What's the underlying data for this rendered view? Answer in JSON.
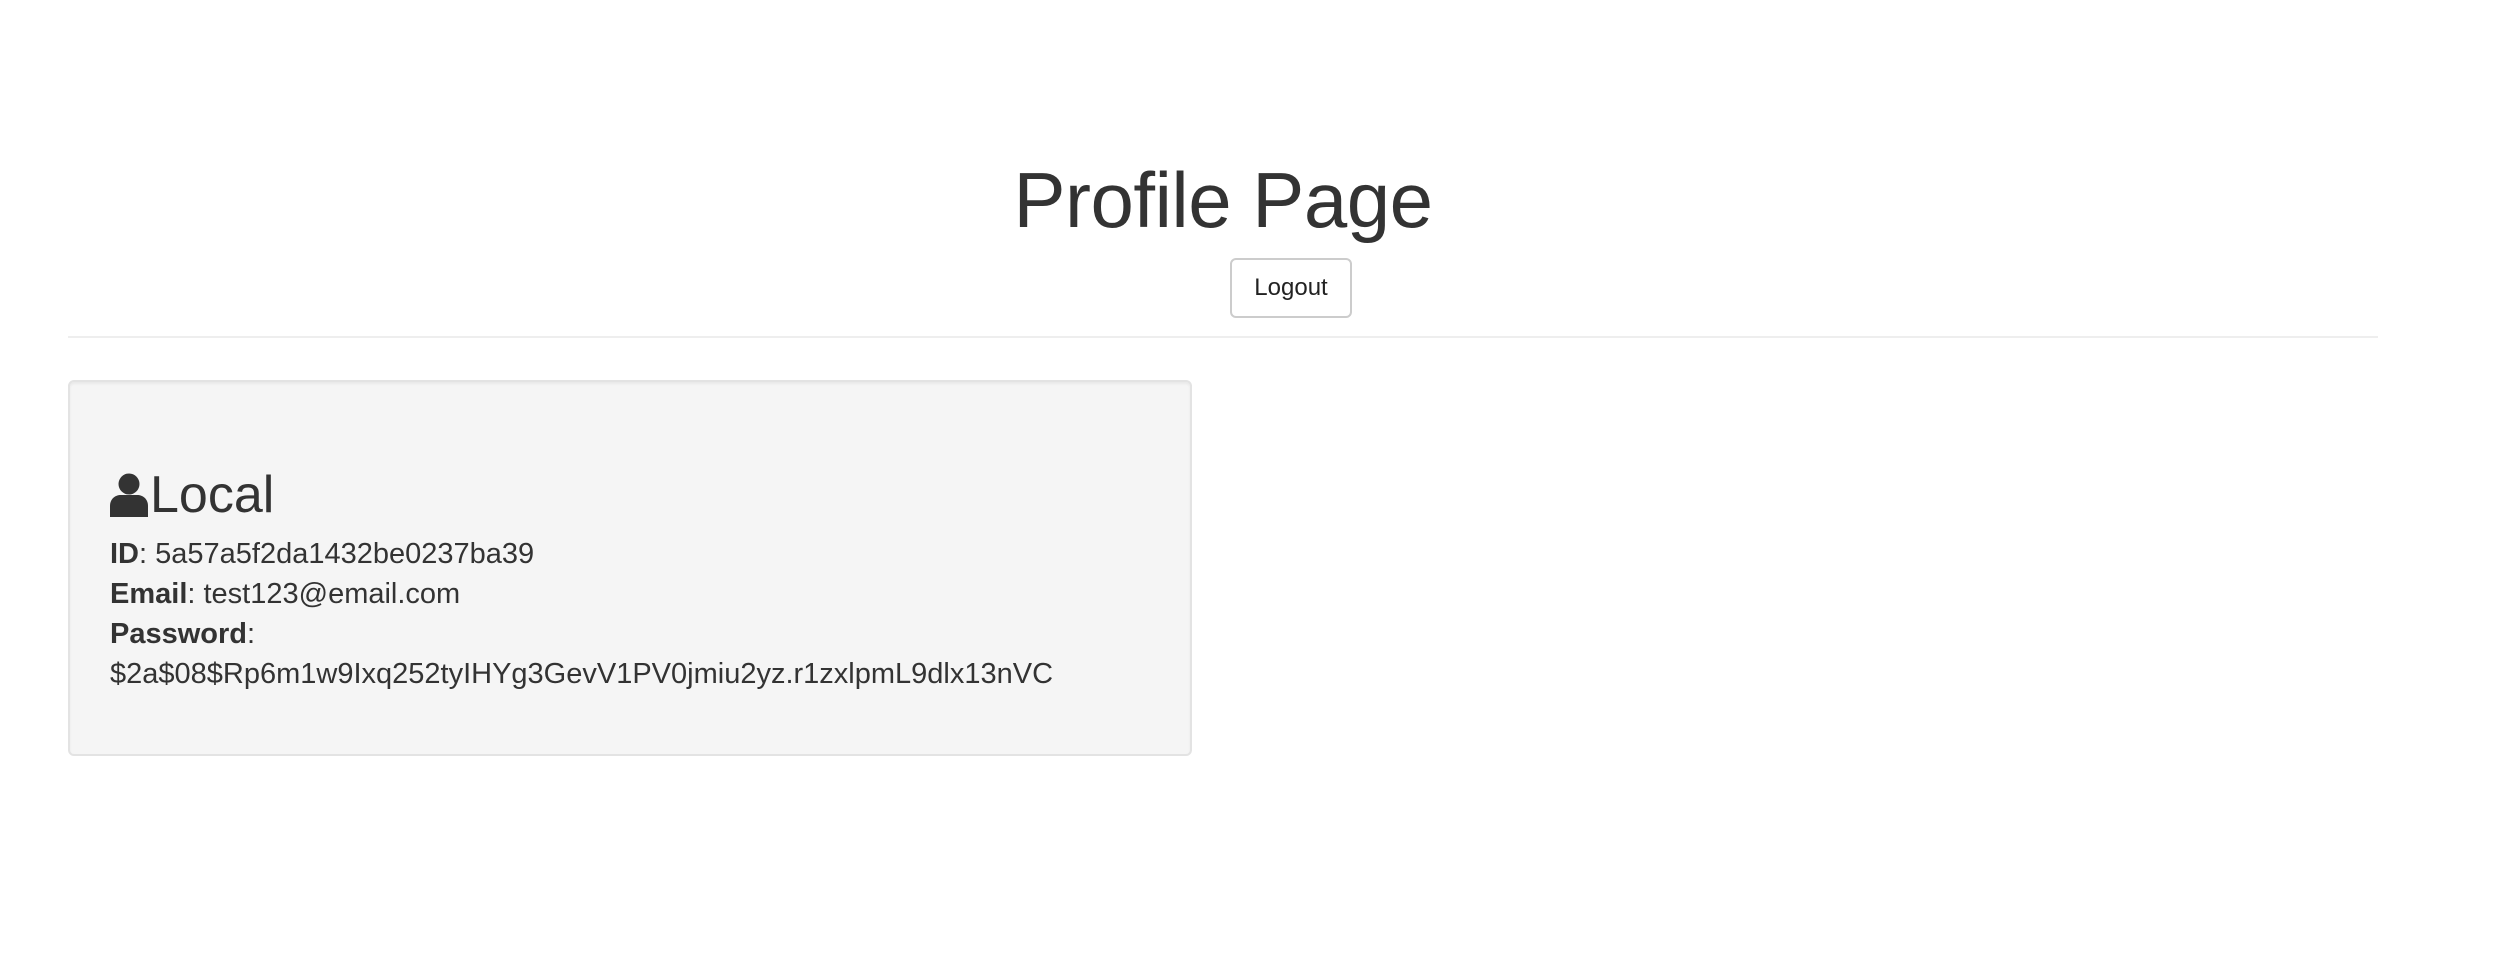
{
  "header": {
    "title": "Profile Page",
    "logout_label": "Logout"
  },
  "local": {
    "heading": "Local",
    "icon": "user-icon",
    "id_label": "ID",
    "id_value": "5a57a5f2da1432be0237ba39",
    "email_label": "Email",
    "email_value": "test123@email.com",
    "password_label": "Password",
    "password_value": "$2a$08$Rp6m1w9Ixq252tyIHYg3GevV1PV0jmiu2yz.r1zxlpmL9dlx13nVC"
  }
}
